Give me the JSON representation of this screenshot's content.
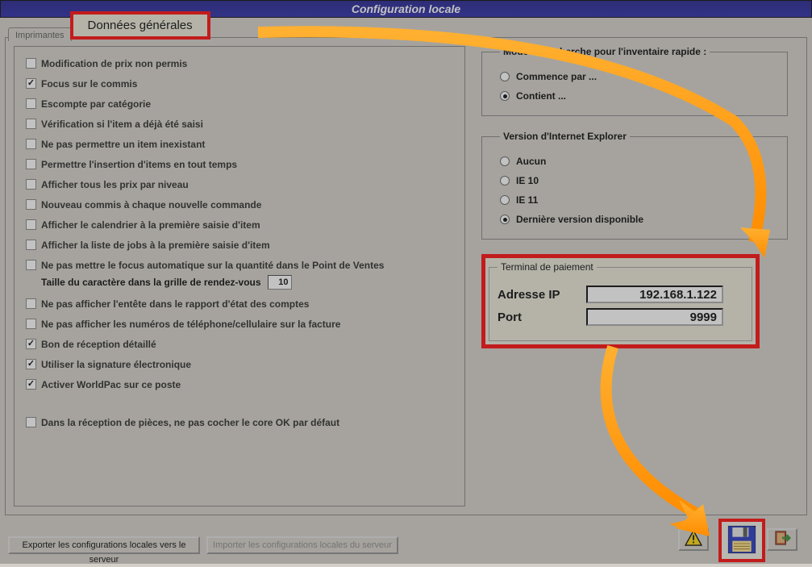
{
  "title": "Configuration locale",
  "tabs": {
    "inactive": "Imprimantes",
    "active": "Données générales"
  },
  "checkboxes": [
    {
      "label": "Modification de prix non permis",
      "checked": false
    },
    {
      "label": "Focus sur le commis",
      "checked": true
    },
    {
      "label": "Escompte par catégorie",
      "checked": false
    },
    {
      "label": "Vérification si l'item a déjà été saisi",
      "checked": false
    },
    {
      "label": "Ne pas permettre un item inexistant",
      "checked": false
    },
    {
      "label": "Permettre l'insertion d'items en tout temps",
      "checked": false
    },
    {
      "label": "Afficher tous les prix par niveau",
      "checked": false
    },
    {
      "label": "Nouveau commis à chaque nouvelle commande",
      "checked": false
    },
    {
      "label": "Afficher le calendrier à la première saisie d'item",
      "checked": false
    },
    {
      "label": "Afficher la liste de jobs à la première saisie d'item",
      "checked": false
    },
    {
      "label": "Ne pas mettre le focus automatique sur la quantité dans le Point de Ventes",
      "checked": false
    },
    {
      "label": "Ne pas afficher l'entête dans le rapport d'état des comptes",
      "checked": false
    },
    {
      "label": "Ne pas afficher les numéros de téléphone/cellulaire sur la facture",
      "checked": false
    },
    {
      "label": "Bon de réception détaillé",
      "checked": true
    },
    {
      "label": "Utiliser la signature électronique",
      "checked": true
    },
    {
      "label": "Activer WorldPac sur ce poste",
      "checked": true
    },
    {
      "label": "Dans la réception de pièces, ne pas cocher le core OK par défaut",
      "checked": false
    }
  ],
  "taille_row": {
    "label": "Taille du caractère dans la grille de rendez-vous",
    "value": "10"
  },
  "search_mode": {
    "legend": "Mode de recherche pour l'inventaire rapide :",
    "options": [
      {
        "label": "Commence par ...",
        "selected": false
      },
      {
        "label": "Contient ...",
        "selected": true
      }
    ]
  },
  "ie_version": {
    "legend": "Version d'Internet Explorer",
    "options": [
      {
        "label": "Aucun",
        "selected": false
      },
      {
        "label": "IE 10",
        "selected": false
      },
      {
        "label": "IE 11",
        "selected": false
      },
      {
        "label": "Dernière version disponible",
        "selected": true
      }
    ]
  },
  "terminal": {
    "legend": "Terminal de paiement",
    "ip_label": "Adresse IP",
    "ip_value": "192.168.1.122",
    "port_label": "Port",
    "port_value": "9999"
  },
  "buttons": {
    "export": "Exporter les configurations locales vers le serveur",
    "import": "Importer les configurations locales du serveur"
  }
}
